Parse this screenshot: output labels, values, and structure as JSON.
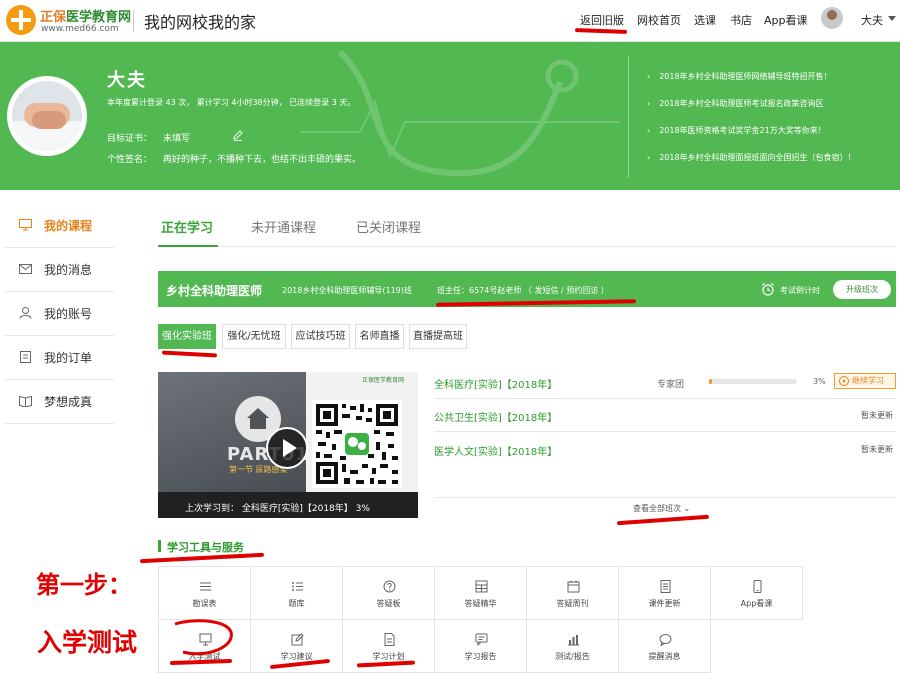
{
  "topbar": {
    "logo_brand_a": "正保",
    "logo_brand_b": "医学教育网",
    "logo_url": "www.med66.com",
    "site_title": "我的网校我的家",
    "nav": [
      "返回旧版",
      "网校首页",
      "选课",
      "书店",
      "App看课"
    ],
    "user": "大夫"
  },
  "profile": {
    "name": "大夫",
    "stats": "本年度累计登录 43 次， 累计学习 4小时38分钟， 已连续登录 3 天。",
    "goal_label": "目标证书：",
    "goal_value": "未填写",
    "sig_label": "个性签名：",
    "sig_value": "再好的种子，不播种下去，也结不出丰硕的果实。"
  },
  "news": [
    "2018年乡村全科助理医师网络辅导班特招开售！",
    "2018年乡村全科助理医师考试报名政策咨询区",
    "2018年医师资格考试奖学金21万大奖等你来！",
    "2018年乡村全科助理面授班面向全国招生（包食宿）！"
  ],
  "sidebar": {
    "items": [
      {
        "label": "我的课程",
        "icon": "monitor-icon"
      },
      {
        "label": "我的消息",
        "icon": "mail-icon"
      },
      {
        "label": "我的账号",
        "icon": "user-icon"
      },
      {
        "label": "我的订单",
        "icon": "document-icon"
      },
      {
        "label": "梦想成真",
        "icon": "book-icon"
      }
    ]
  },
  "tabs": [
    "正在学习",
    "未开通课程",
    "已关闭课程"
  ],
  "course": {
    "name": "乡村全科助理医师",
    "class": "2018乡村全科助理医师辅导(119)班",
    "teacher": "班主任：6574号赵老师 （ 发短信 / 预约回访 ）",
    "countdown_label": "考试倒计时",
    "upgrade": "升级班次"
  },
  "sub_tabs": [
    "强化实验班",
    "强化/无忧班",
    "应试技巧班",
    "名师直播",
    "直播提高班"
  ],
  "video": {
    "part": "PART01",
    "part_sub": "第一节 尿路感染",
    "qr_header": "正保医学教育网",
    "caption": "上次学习到：   全科医疗[实验]【2018年】   3%"
  },
  "lessons": [
    {
      "name": "全科医疗[实验]【2018年】",
      "teacher": "专家团",
      "progress": 3,
      "progress_text": "3%",
      "action": "继续学习"
    },
    {
      "name": "公共卫生[实验]【2018年】",
      "status": "暂未更新"
    },
    {
      "name": "医学人文[实验]【2018年】",
      "status": "暂未更新"
    }
  ],
  "view_all": "查看全部班次",
  "tools": {
    "title": "学习工具与服务",
    "items": [
      {
        "label": "勘误表",
        "icon": "menu-icon"
      },
      {
        "label": "题库",
        "icon": "list-icon"
      },
      {
        "label": "答疑板",
        "icon": "question-icon"
      },
      {
        "label": "答疑精华",
        "icon": "grid-icon"
      },
      {
        "label": "答疑周刊",
        "icon": "calendar-icon"
      },
      {
        "label": "课件更新",
        "icon": "doc-icon"
      },
      {
        "label": "App看课",
        "icon": "phone-icon"
      },
      {
        "label": "入学测试",
        "icon": "screen-icon"
      },
      {
        "label": "学习建议",
        "icon": "edit-icon"
      },
      {
        "label": "学习计划",
        "icon": "file-icon"
      },
      {
        "label": "学习报告",
        "icon": "chat-icon"
      },
      {
        "label": "测试/报告",
        "icon": "chart-icon"
      },
      {
        "label": "提醒消息",
        "icon": "bubble-icon"
      }
    ]
  },
  "annotation": {
    "step": "第一步：",
    "step_sub": "入学测试"
  }
}
